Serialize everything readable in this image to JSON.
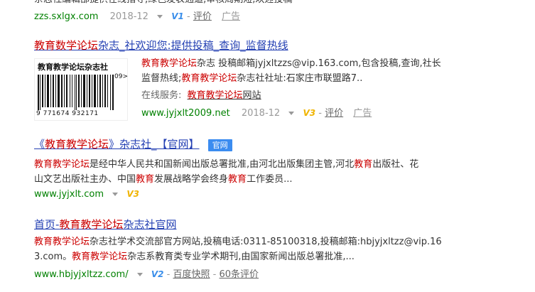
{
  "result0": {
    "snippet": "杂志社编辑部提供在线指导,绿色发表通道,审核周期短,欢迎投稿",
    "url": "zzs.sxlgx.com",
    "date": "2018-12",
    "vbadge": "V1",
    "separator": "-",
    "review": "评价",
    "ad": "广告"
  },
  "result1": {
    "title_hl": "教育数学论坛",
    "title_rest": "杂志_社欢迎您:提供投稿_查询_监督热线",
    "logo_text": "教育教学论坛杂志社",
    "barcode_number": "9 771674 932171",
    "barcode_side": "09>",
    "line1_hl": "教育教学论坛",
    "line1_rest": "杂志 投稿邮箱jyjxltzzs@vip.163.com,包含投稿,查询,社长",
    "line2_a": "监督热线;",
    "line2_hl": "教育教学论坛",
    "line2_rest": "杂志社社址:石家庄市联盟路7..",
    "service_label": "在线服务:",
    "service_hl": "教育教学论坛",
    "service_rest": "网站",
    "url": "www.jyjxlt2009.net",
    "date": "2018-12",
    "vbadge": "V3",
    "separator": "-",
    "review": "评价",
    "ad": "广告"
  },
  "result2": {
    "title_pre": "《",
    "title_hl": "教育教学论坛",
    "title_rest": "》杂志社_【官网】",
    "badge": "官网",
    "line1_hl1": "教育教学论坛",
    "line1_rest1": "是经中华人民共和国新闻出版总署批准,由河北出版集团主管,河北",
    "line1_hl2": "教育",
    "line1_rest2": "出版社、花",
    "line2_a": "山文艺出版社主办、中国",
    "line2_hl1": "教育",
    "line2_b": "发展战略学会终身",
    "line2_hl2": "教育",
    "line2_c": "工作委员...",
    "url": "www.jyjxlt.com",
    "vbadge": "V3"
  },
  "result3": {
    "title_pre": "首页-",
    "title_hl": "教育教学论坛",
    "title_rest": "杂志社官网",
    "line1_hl": "教育教学论坛",
    "line1_rest": "杂志社学术交流部官方网站,投稿电话:0311-85100318,投稿邮箱:hbjyjxltzz@vip.16",
    "line2_a": "3.com。",
    "line2_hl": "教育教学论坛",
    "line2_rest": "杂志系教育类专业学术期刊,由国家新闻出版总署批准,...",
    "url": "www.hbjyjxltzz.com/",
    "vbadge": "V2",
    "separator": "-",
    "snapshot": "百度快照",
    "separator2": "-",
    "reviews": "60条评价"
  }
}
